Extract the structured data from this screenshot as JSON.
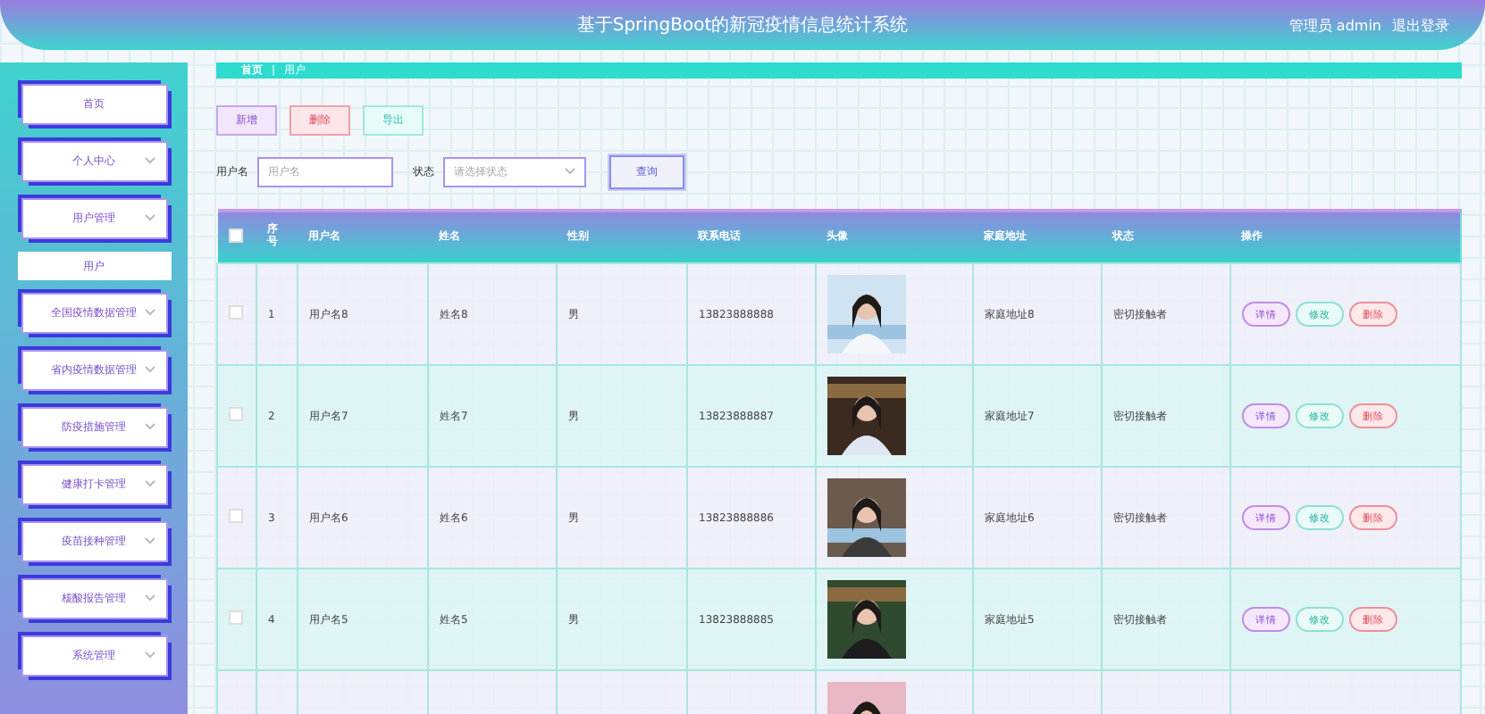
{
  "header": {
    "title": "基于SpringBoot的新冠疫情信息统计系统",
    "user": "管理员 admin",
    "logout": "退出登录"
  },
  "sidebar": {
    "items": [
      {
        "label": "首页",
        "kind": "link"
      },
      {
        "label": "个人中心",
        "kind": "menu"
      },
      {
        "label": "用户管理",
        "kind": "menu"
      },
      {
        "label": "用户",
        "kind": "submenu"
      },
      {
        "label": "全国疫情数据管理",
        "kind": "menu"
      },
      {
        "label": "省内疫情数据管理",
        "kind": "menu"
      },
      {
        "label": "防疫措施管理",
        "kind": "menu"
      },
      {
        "label": "健康打卡管理",
        "kind": "menu"
      },
      {
        "label": "疫苗接种管理",
        "kind": "menu"
      },
      {
        "label": "核酸报告管理",
        "kind": "menu"
      },
      {
        "label": "系统管理",
        "kind": "menu"
      }
    ]
  },
  "breadcrumb": [
    "首页",
    "用户"
  ],
  "breadcrumb_separator": "|",
  "actions": [
    {
      "label": "新增",
      "kind": "add"
    },
    {
      "label": "删除",
      "kind": "delete"
    },
    {
      "label": "导出",
      "kind": "export"
    }
  ],
  "search": {
    "fields": [
      {
        "label": "用户名",
        "placeholder": "用户名",
        "kind": "input"
      },
      {
        "label": "状态",
        "placeholder": "请选择状态",
        "kind": "select"
      }
    ],
    "button": "查询"
  },
  "table": {
    "select_all_checked": false,
    "columns": [
      "序号",
      "用户名",
      "姓名",
      "性别",
      "联系电话",
      "头像",
      "家庭地址",
      "状态",
      "操作"
    ],
    "rows": [
      {
        "kind": "full",
        "checked": false,
        "index": "1",
        "username": "用户名8",
        "name": "姓名8",
        "gender": "男",
        "phone": "13823888888",
        "address": "家庭地址8",
        "status": "密切接触者",
        "buttons": [
          "详情",
          "修改",
          "删除"
        ]
      },
      {
        "kind": "full",
        "checked": false,
        "index": "2",
        "username": "用户名7",
        "name": "姓名7",
        "gender": "男",
        "phone": "13823888887",
        "address": "家庭地址7",
        "status": "密切接触者",
        "buttons": [
          "详情",
          "修改",
          "删除"
        ]
      },
      {
        "kind": "full",
        "checked": false,
        "index": "3",
        "username": "用户名6",
        "name": "姓名6",
        "gender": "男",
        "phone": "13823888886",
        "address": "家庭地址6",
        "status": "密切接触者",
        "buttons": [
          "详情",
          "修改",
          "删除"
        ]
      },
      {
        "kind": "full",
        "checked": false,
        "index": "4",
        "username": "用户名5",
        "name": "姓名5",
        "gender": "男",
        "phone": "13823888885",
        "address": "家庭地址5",
        "status": "密切接触者",
        "buttons": [
          "详情",
          "修改",
          "删除"
        ]
      },
      {
        "kind": "partial"
      }
    ]
  }
}
